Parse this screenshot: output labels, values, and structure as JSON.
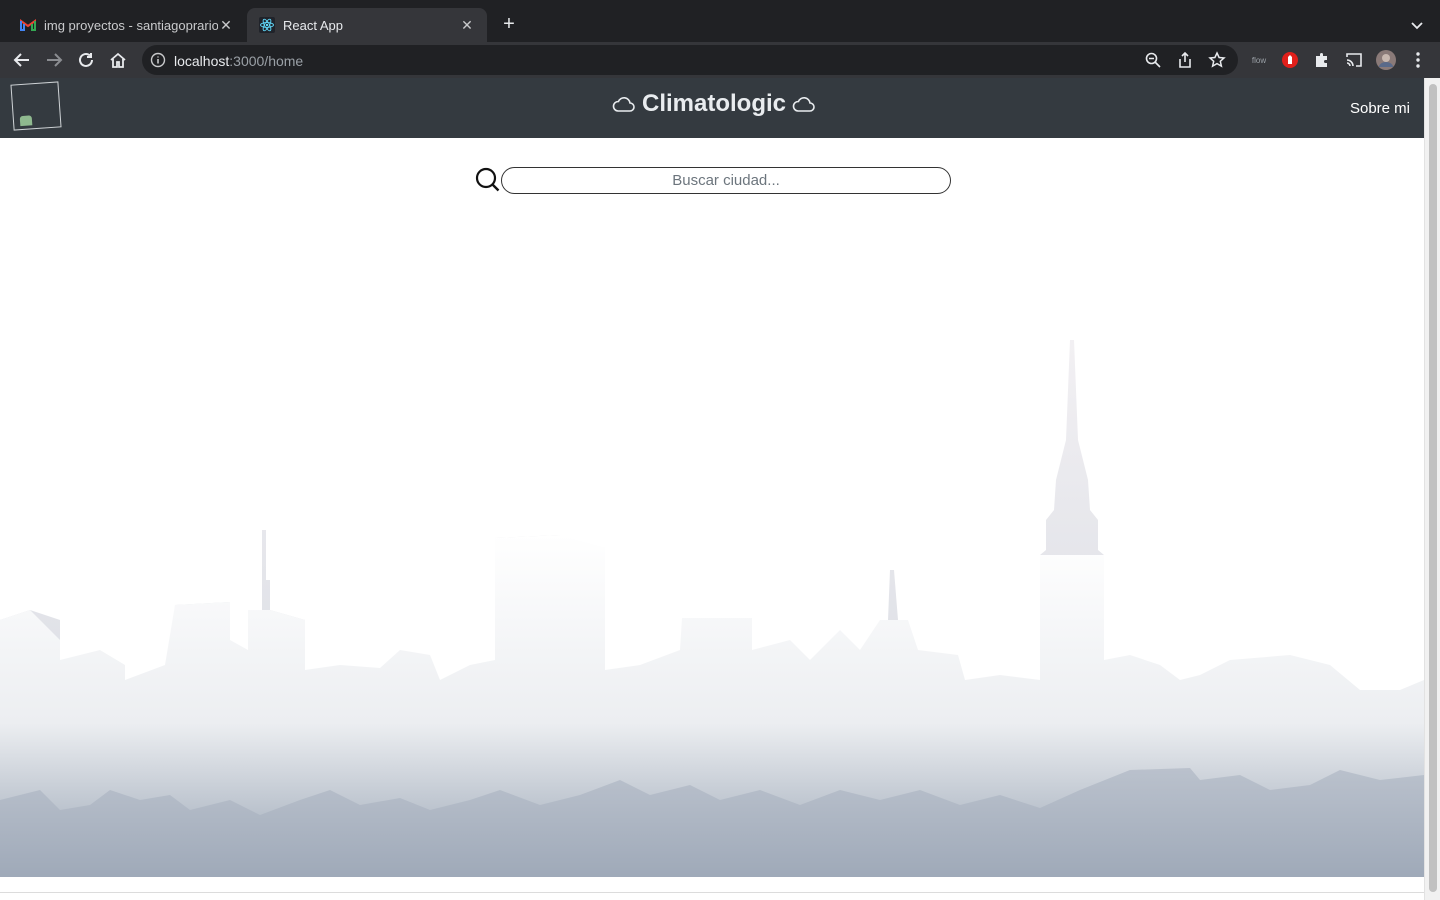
{
  "browser": {
    "tabs": [
      {
        "title": "img proyectos - santiagoprario",
        "active": false,
        "favicon": "gmail-icon"
      },
      {
        "title": "React App",
        "active": true,
        "favicon": "react-icon"
      }
    ],
    "url_host": "localhost",
    "url_path": ":3000/home",
    "extensions": [
      "zoom-icon",
      "share-icon",
      "bookmark-star-icon",
      "flow-extension-icon",
      "red-extension-icon",
      "puzzle-icon",
      "cast-icon",
      "profile-avatar",
      "menu-kebab-icon"
    ],
    "flow_label": "flow"
  },
  "app": {
    "title": "Climatologic",
    "nav_link": "Sobre mi",
    "search": {
      "placeholder": "Buscar ciudad...",
      "value": ""
    },
    "colors": {
      "navbar": "#343a40",
      "skyline": "#9aa6b6"
    }
  }
}
